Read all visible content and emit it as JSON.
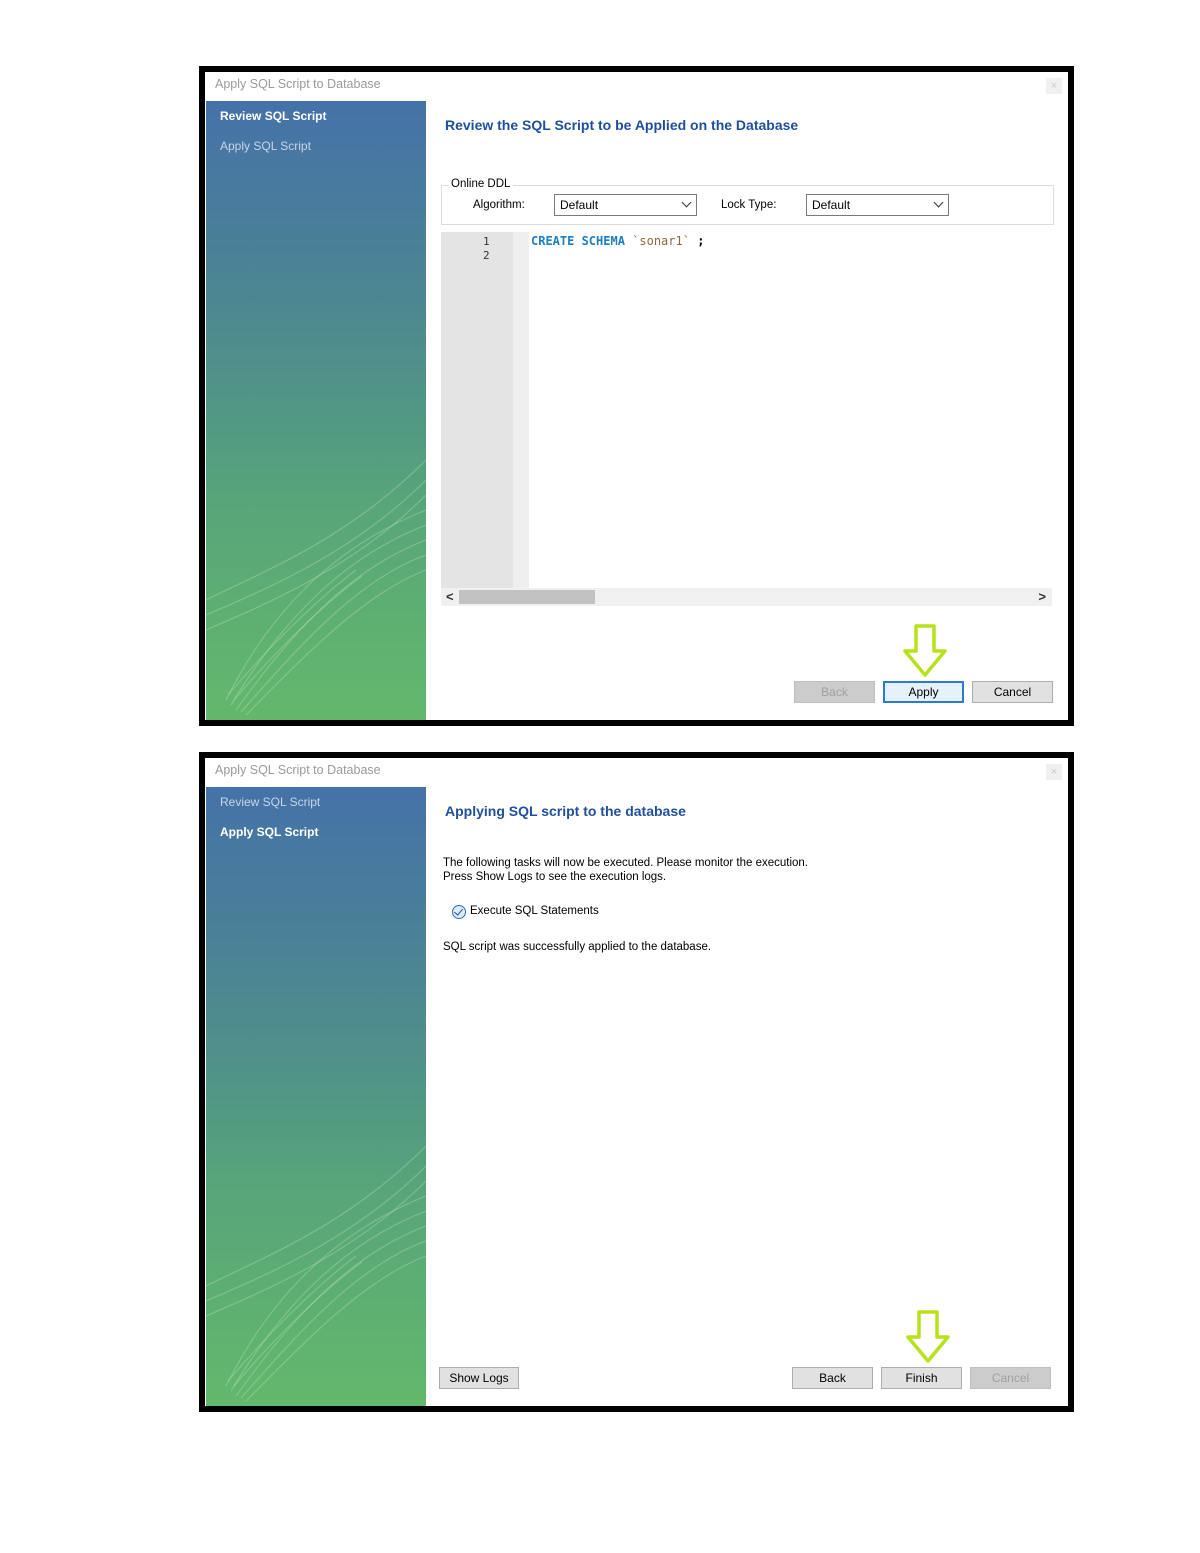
{
  "screens": [
    {
      "window_title": "Apply SQL Script to Database",
      "close_glyph": "×",
      "steps": [
        {
          "label": "Review SQL Script",
          "active": true
        },
        {
          "label": "Apply SQL Script",
          "active": false
        }
      ],
      "heading": "Review the SQL Script to be Applied on the Database",
      "online_ddl": {
        "legend": "Online DDL",
        "algorithm_label": "Algorithm:",
        "algorithm_value": "Default",
        "lock_type_label": "Lock Type:",
        "lock_type_value": "Default"
      },
      "editor": {
        "line_numbers": [
          "1",
          "2"
        ],
        "code_keyword": "CREATE SCHEMA",
        "code_string": "`sonar1`",
        "code_end": ";"
      },
      "scroll_left": "<",
      "scroll_right": ">",
      "buttons": {
        "back": "Back",
        "apply": "Apply",
        "cancel": "Cancel"
      },
      "highlight_arrow_color": "#b6e21a"
    },
    {
      "window_title": "Apply SQL Script to Database",
      "close_glyph": "×",
      "steps": [
        {
          "label": "Review SQL Script",
          "active": false
        },
        {
          "label": "Apply SQL Script",
          "active": true
        }
      ],
      "heading": "Applying SQL script to the database",
      "description_line1": "The following tasks will now be executed. Please monitor the execution.",
      "description_line2": "Press Show Logs to see the execution logs.",
      "task": "Execute SQL Statements",
      "status": "SQL script was successfully applied to the database.",
      "buttons": {
        "show_logs": "Show Logs",
        "back": "Back",
        "finish": "Finish",
        "cancel": "Cancel"
      },
      "highlight_arrow_color": "#b6e21a"
    }
  ]
}
